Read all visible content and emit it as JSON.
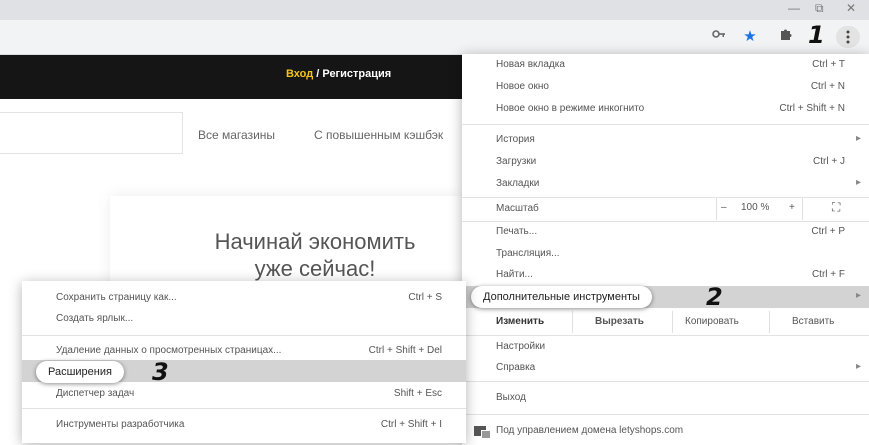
{
  "window": {
    "minimize": "—",
    "restore": "⧉",
    "close": "✕"
  },
  "toolbar": {
    "key_icon": "key-icon",
    "bookmark_icon": "star-icon",
    "extensions_icon": "puzzle-icon",
    "menu_icon": "kebab-menu-icon",
    "accent_color": "#1a73e8"
  },
  "annotations": {
    "step1": "1",
    "step2": "2",
    "step3": "3"
  },
  "site": {
    "login": "Вход",
    "register": "/ Регистрация",
    "nav_all": "Все магазины",
    "nav_cashback": "С повышенным кэшбэк",
    "promo_line1": "Начинай экономить",
    "promo_line2": "уже сейчас!",
    "brand_color": "#f5c518"
  },
  "main_menu": {
    "new_tab": "Новая вкладка",
    "new_tab_sc": "Ctrl + T",
    "new_window": "Новое окно",
    "new_window_sc": "Ctrl + N",
    "incognito": "Новое окно в режиме инкогнито",
    "incognito_sc": "Ctrl + Shift + N",
    "history": "История",
    "downloads": "Загрузки",
    "downloads_sc": "Ctrl + J",
    "bookmarks": "Закладки",
    "zoom": "Масштаб",
    "zoom_minus": "–",
    "zoom_value": "100 %",
    "zoom_plus": "+",
    "fullscreen": "⛶",
    "print": "Печать...",
    "print_sc": "Ctrl + P",
    "cast": "Трансляция...",
    "find": "Найти...",
    "find_sc": "Ctrl + F",
    "more_tools": "Дополнительные инструменты",
    "edit": "Изменить",
    "cut": "Вырезать",
    "copy": "Копировать",
    "paste": "Вставить",
    "settings": "Настройки",
    "help": "Справка",
    "exit": "Выход",
    "managed": "Под управлением домена letyshops.com",
    "arrow": "▸"
  },
  "sub_menu": {
    "save_page": "Сохранить страницу как...",
    "save_page_sc": "Ctrl + S",
    "create_shortcut": "Создать ярлык...",
    "clear_data": "Удаление данных о просмотренных страницах...",
    "clear_data_sc": "Ctrl + Shift + Del",
    "extensions": "Расширения",
    "task_manager": "Диспетчер задач",
    "task_manager_sc": "Shift + Esc",
    "dev_tools": "Инструменты разработчика",
    "dev_tools_sc": "Ctrl + Shift + I"
  }
}
